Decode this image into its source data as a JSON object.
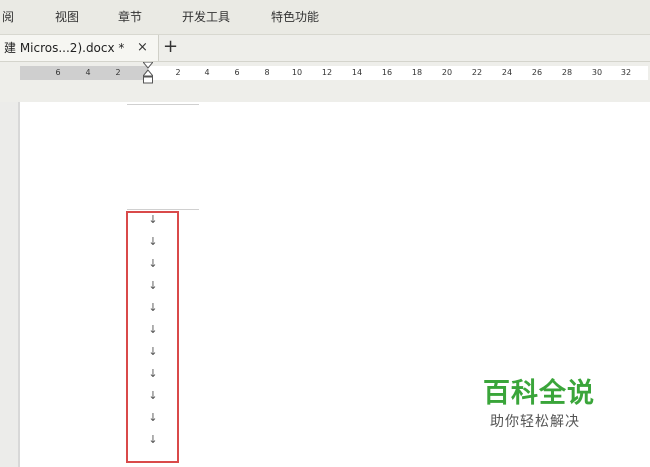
{
  "menubar": {
    "items": [
      "阅",
      "视图",
      "章节",
      "开发工具",
      "特色功能"
    ]
  },
  "tabs": {
    "active": {
      "title": "建 Micros...2).docx *",
      "close_glyph": "×"
    },
    "new_tab_glyph": "+"
  },
  "ruler": {
    "ticks": [
      "6",
      "4",
      "2",
      "2",
      "4",
      "6",
      "8",
      "10",
      "12",
      "14",
      "16",
      "18",
      "20",
      "22",
      "24",
      "26",
      "28",
      "30",
      "32"
    ]
  },
  "document": {
    "paragraph_mark": "↓",
    "paragraph_mark_count": 11,
    "selection_color": "#d94a4a"
  },
  "watermark": {
    "title": "百科全说",
    "subtitle": "助你轻松解决",
    "color": "#3aa53a"
  }
}
